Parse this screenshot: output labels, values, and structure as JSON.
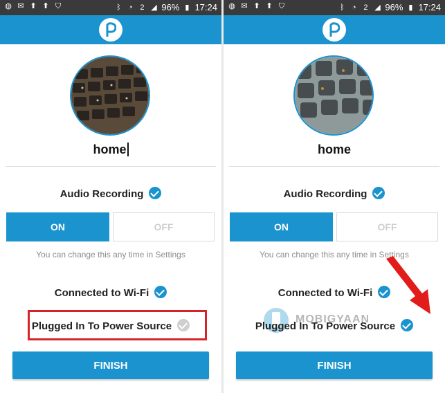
{
  "status_bar": {
    "battery": "96%",
    "time": "17:24",
    "sim_badge": "2",
    "notification_icons": [
      "samsung-icon",
      "mail-icon",
      "upload-icon",
      "upload-icon",
      "shield-icon"
    ],
    "system_icons": [
      "bluetooth-icon",
      "wifi-icon",
      "signal-icon",
      "battery-icon"
    ]
  },
  "app_bar": {
    "logo_icon": "p-logo-icon",
    "color": "#1a93cf"
  },
  "screens": [
    {
      "camera_name": "home",
      "audio_recording_label": "Audio Recording",
      "toggle_on": "ON",
      "toggle_off": "OFF",
      "hint": "You can change this any time in Settings",
      "wifi_label": "Connected to Wi-Fi",
      "power_label": "Plugged In To Power Source",
      "power_status": "unchecked",
      "finish_label": "FINISH"
    },
    {
      "camera_name": "home",
      "audio_recording_label": "Audio Recording",
      "toggle_on": "ON",
      "toggle_off": "OFF",
      "hint": "You can change this any time in Settings",
      "wifi_label": "Connected to Wi-Fi",
      "power_label": "Plugged In To Power Source",
      "power_status": "checked",
      "finish_label": "FINISH",
      "watermark": "MOBIGYAAN"
    }
  ],
  "colors": {
    "accent": "#1a93cf",
    "highlight": "#d9232a",
    "arrow": "#e21b1b"
  }
}
